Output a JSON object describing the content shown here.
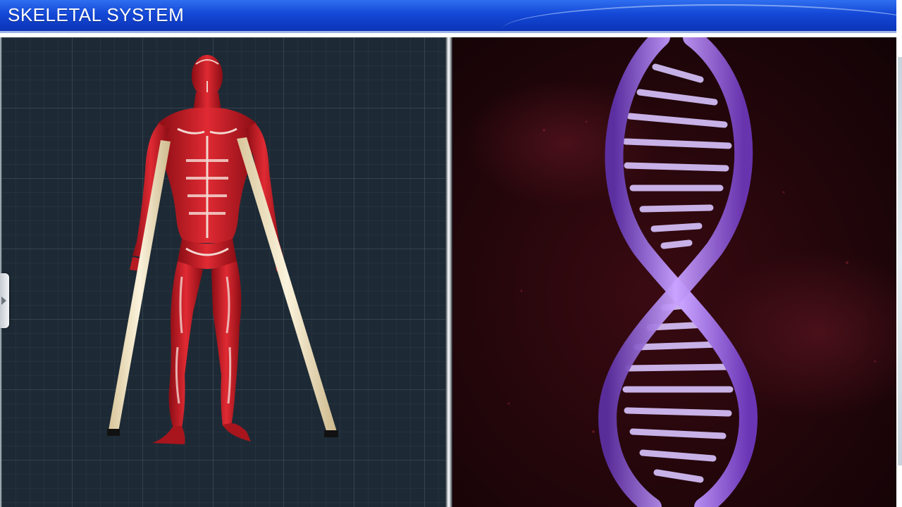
{
  "header": {
    "title": "SKELETAL SYSTEM"
  },
  "left_panel": {
    "figure_icon": "muscular-human-figure"
  },
  "right_panel": {
    "figure_icon": "dna-double-helix"
  },
  "colors": {
    "title_bar": "#1448d6",
    "grid_background": "#1d2a35",
    "muscle": "#c81e28",
    "sticks": "#efe3c0",
    "dna": "#a070e0",
    "dna_background": "#22060a"
  }
}
